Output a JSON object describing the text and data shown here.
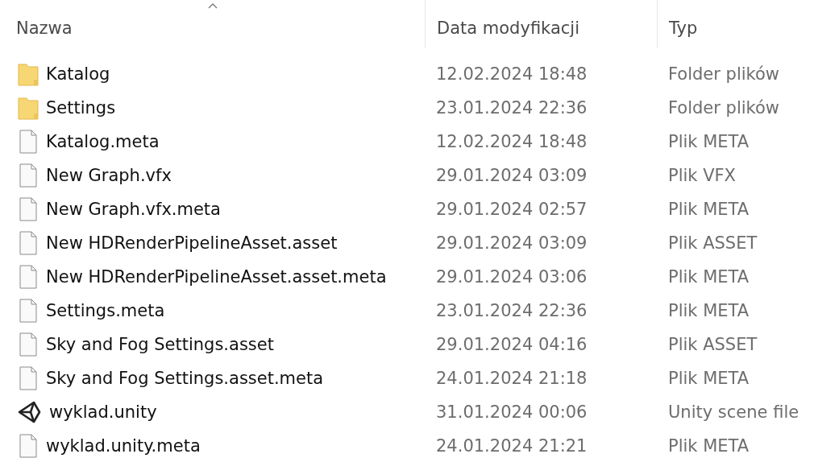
{
  "columns": [
    {
      "label": "Nazwa",
      "sorted": true
    },
    {
      "label": "Data modyfikacji",
      "sorted": false
    },
    {
      "label": "Typ",
      "sorted": false
    }
  ],
  "rows": [
    {
      "kind": "folder",
      "name": "Katalog",
      "date": "12.02.2024 18:48",
      "type": "Folder plików"
    },
    {
      "kind": "folder",
      "name": "Settings",
      "date": "23.01.2024 22:36",
      "type": "Folder plików"
    },
    {
      "kind": "file",
      "name": "Katalog.meta",
      "date": "12.02.2024 18:48",
      "type": "Plik META"
    },
    {
      "kind": "file",
      "name": "New Graph.vfx",
      "date": "29.01.2024 03:09",
      "type": "Plik VFX"
    },
    {
      "kind": "file",
      "name": "New Graph.vfx.meta",
      "date": "29.01.2024 02:57",
      "type": "Plik META"
    },
    {
      "kind": "file",
      "name": "New HDRenderPipelineAsset.asset",
      "date": "29.01.2024 03:09",
      "type": "Plik ASSET"
    },
    {
      "kind": "file",
      "name": "New HDRenderPipelineAsset.asset.meta",
      "date": "29.01.2024 03:06",
      "type": "Plik META"
    },
    {
      "kind": "file",
      "name": "Settings.meta",
      "date": "23.01.2024 22:36",
      "type": "Plik META"
    },
    {
      "kind": "file",
      "name": "Sky and Fog Settings.asset",
      "date": "29.01.2024 04:16",
      "type": "Plik ASSET"
    },
    {
      "kind": "file",
      "name": "Sky and Fog Settings.asset.meta",
      "date": "24.01.2024 21:18",
      "type": "Plik META"
    },
    {
      "kind": "unity",
      "name": "wyklad.unity",
      "date": "31.01.2024 00:06",
      "type": "Unity scene file"
    },
    {
      "kind": "file",
      "name": "wyklad.unity.meta",
      "date": "24.01.2024 21:21",
      "type": "Plik META"
    }
  ]
}
